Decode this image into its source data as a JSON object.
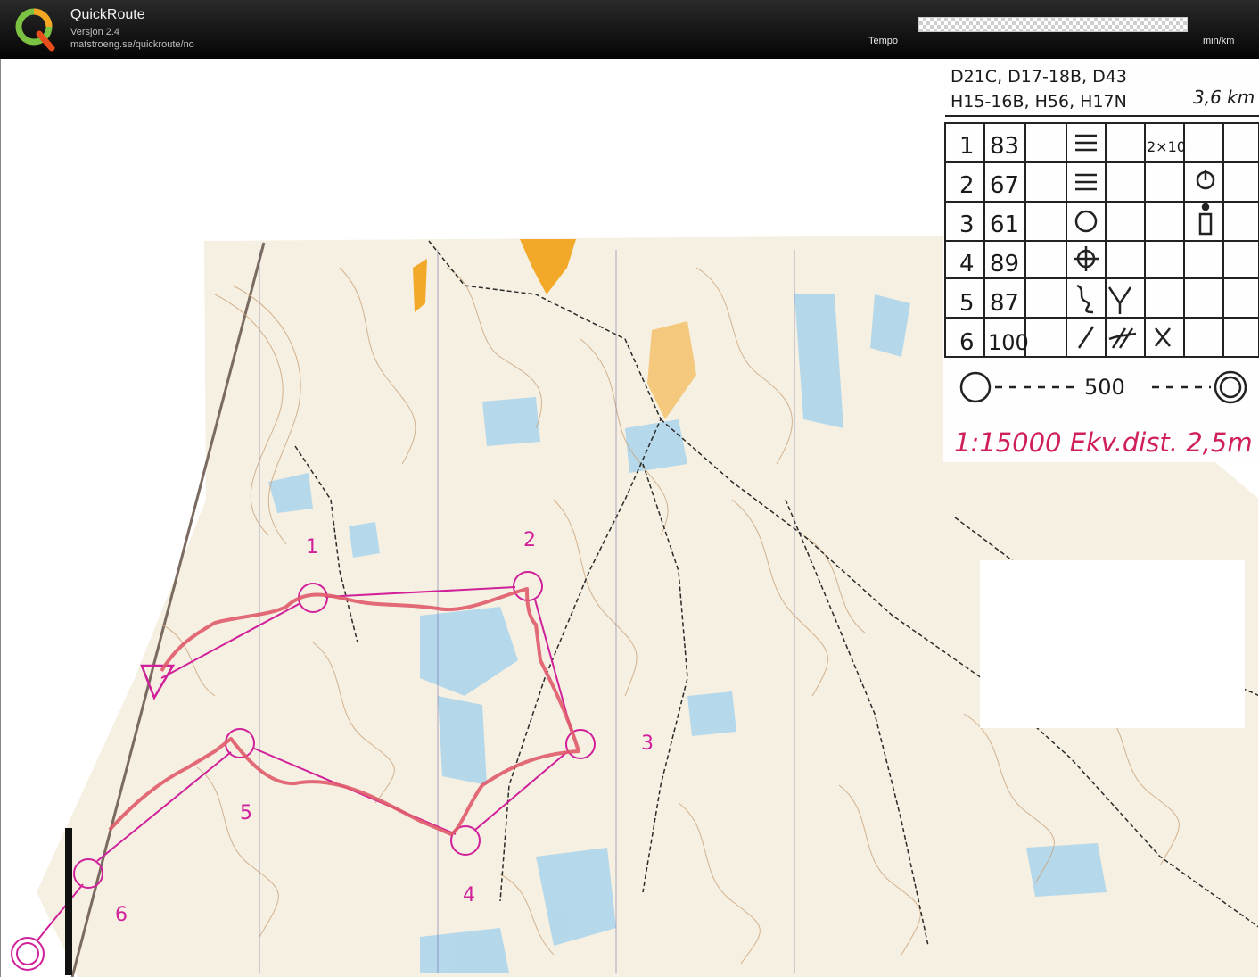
{
  "header": {
    "app_name": "QuickRoute",
    "version": "Versjon 2.4",
    "url": "matstroeng.se/quickroute/no",
    "tempo_label": "Tempo",
    "unit_label": "min/km",
    "logo_letter": "Q",
    "logo_colors": [
      "#7cc242",
      "#f5a623",
      "#e84e1b"
    ]
  },
  "course": {
    "classes_line1": "D21C, D17-18B, D43",
    "classes_line2": "H15-16B, H56, H17N",
    "length": "3,6 km",
    "scale_note": "1:15000  Ekv.dist. 2,5m",
    "leg_distance": "500",
    "controls": [
      {
        "number": "1",
        "code": "83",
        "extra": "2×10"
      },
      {
        "number": "2",
        "code": "67",
        "extra": ""
      },
      {
        "number": "3",
        "code": "61",
        "extra": ""
      },
      {
        "number": "4",
        "code": "89",
        "extra": ""
      },
      {
        "number": "5",
        "code": "87",
        "extra": ""
      },
      {
        "number": "6",
        "code": "100",
        "extra": ""
      }
    ],
    "map_labels": [
      "1",
      "2",
      "3",
      "4",
      "5",
      "6"
    ]
  },
  "colors": {
    "route": "#e05a6a",
    "course": "#d0209a",
    "water": "#a9d4ec",
    "paper": "#f7f1e3",
    "contour": "#c9a27a",
    "open_land": "#f2a92a"
  }
}
